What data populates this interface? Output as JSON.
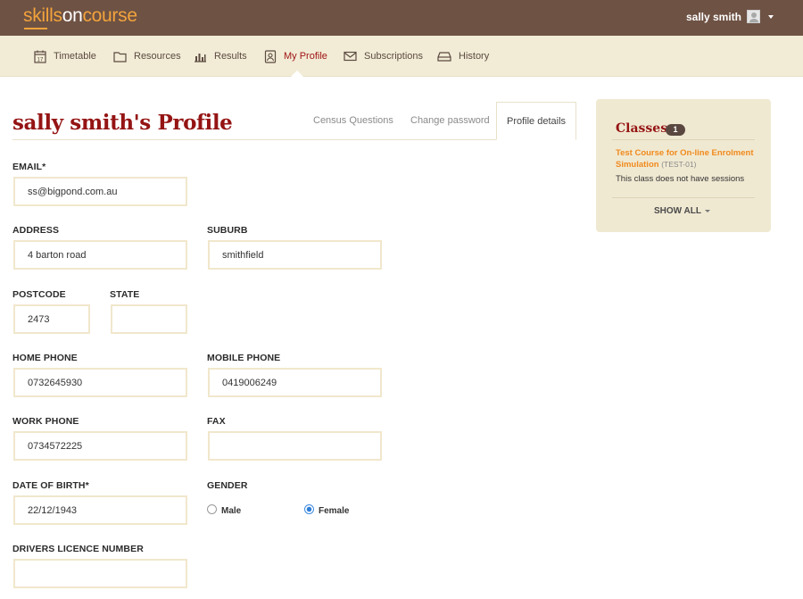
{
  "app": {
    "logo_part1": "skills",
    "logo_part2": "on",
    "logo_part3": "course"
  },
  "user": {
    "name": "sally smith"
  },
  "nav": {
    "items": [
      {
        "label": "Timetable",
        "icon": "calendar-icon"
      },
      {
        "label": "Resources",
        "icon": "folder-icon"
      },
      {
        "label": "Results",
        "icon": "bar-chart-icon"
      },
      {
        "label": "My Profile",
        "icon": "profile-icon",
        "active": true
      },
      {
        "label": "Subscriptions",
        "icon": "envelope-icon"
      },
      {
        "label": "History",
        "icon": "inbox-icon"
      }
    ]
  },
  "page": {
    "title": "sally smith's Profile"
  },
  "tabs": [
    {
      "label": "Census Questions"
    },
    {
      "label": "Change password"
    },
    {
      "label": "Profile details",
      "active": true
    }
  ],
  "form": {
    "email": {
      "label": "EMAIL*",
      "value": "ss@bigpond.com.au"
    },
    "address": {
      "label": "ADDRESS",
      "value": "4 barton road"
    },
    "suburb": {
      "label": "SUBURB",
      "value": "smithfield"
    },
    "postcode": {
      "label": "POSTCODE",
      "value": "2473"
    },
    "state": {
      "label": "STATE",
      "value": ""
    },
    "home_phone": {
      "label": "HOME PHONE",
      "value": "0732645930"
    },
    "mobile_phone": {
      "label": "MOBILE PHONE",
      "value": "0419006249"
    },
    "work_phone": {
      "label": "WORK PHONE",
      "value": "0734572225"
    },
    "fax": {
      "label": "FAX",
      "value": ""
    },
    "dob": {
      "label": "DATE OF BIRTH*",
      "value": "22/12/1943"
    },
    "gender": {
      "label": "GENDER",
      "options": [
        "Male",
        "Female"
      ],
      "selected": "Female"
    },
    "licence": {
      "label": "DRIVERS LICENCE NUMBER",
      "value": ""
    }
  },
  "sidebar": {
    "title": "Classes",
    "count": "1",
    "course_name": "Test Course for On-line Enrolment Simulation",
    "course_code": "(TEST-01)",
    "note": "This class does not have sessions",
    "show_all": "SHOW ALL"
  },
  "colors": {
    "topbar": "#6e5244",
    "nav": "#f2ecd6",
    "accent_red": "#951414",
    "accent_orange": "#f08a1d"
  }
}
